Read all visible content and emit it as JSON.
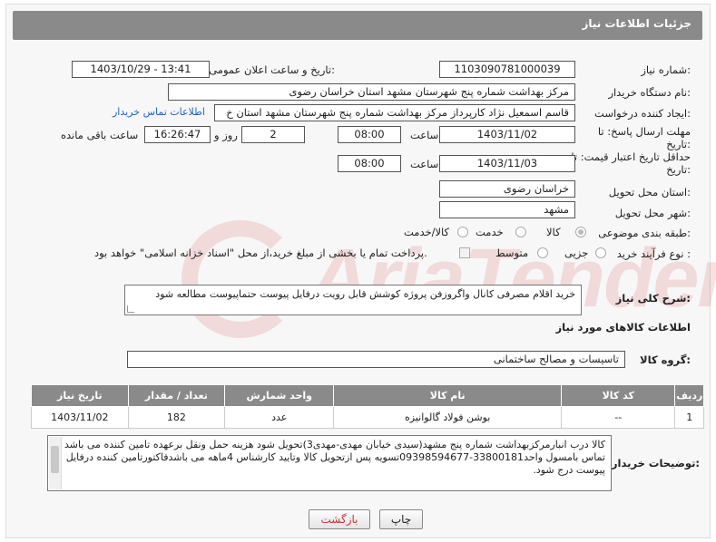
{
  "header": {
    "title": "جزئیات اطلاعات نیاز"
  },
  "need_number": {
    "label": "شماره نیاز:",
    "value": "1103090781000039"
  },
  "announce": {
    "label": "تاریخ و ساعت اعلان عمومی:",
    "value": "1403/10/29 - 13:41"
  },
  "buyer_org": {
    "label": "نام دستگاه خریدار:",
    "value": "مرکز بهداشت شماره پنج شهرستان مشهد استان خراسان رضوی"
  },
  "requester": {
    "label": "ایجاد کننده درخواست:",
    "value": "قاسم  اسمعیل نژاد کارپرداز مرکز بهداشت شماره پنج شهرستان مشهد استان خ",
    "contact_link": "اطلاعات تماس خریدار"
  },
  "deadline": {
    "label_line1": "مهلت ارسال پاسخ: تا",
    "label_line2": "تاریخ:",
    "date": "1403/11/02",
    "time_label": "ساعت",
    "time": "08:00",
    "days": "2",
    "day_label": "روز و",
    "remaining": "16:26:47",
    "remaining_label": "ساعت باقی مانده"
  },
  "validity": {
    "label_line1": "حداقل تاریخ اعتبار قیمت: تا",
    "label_line2": "تاریخ:",
    "date": "1403/11/03",
    "time_label": "ساعت",
    "time": "08:00"
  },
  "delivery_province": {
    "label": "استان محل تحویل:",
    "value": "خراسان رضوی"
  },
  "delivery_city": {
    "label": "شهر محل تحویل:",
    "value": "مشهد"
  },
  "category": {
    "label": "طبقه بندی موضوعی:",
    "options": [
      "کالا",
      "خدمت",
      "کالا/خدمت"
    ]
  },
  "purchase_type": {
    "label": "نوع فرآیند خرید :",
    "options": [
      "جزیی",
      "متوسط"
    ],
    "payment_note": "پرداخت تمام یا بخشی از مبلغ خرید،از محل \"اسناد خزانه اسلامی\" خواهد بود."
  },
  "summary": {
    "label": "شرح کلی نیاز:",
    "value": "خرید اقلام مصرفی کانال واگروزفن پروژه کوشش قابل رویت درفایل پیوست حتماپیوست مطالعه شود"
  },
  "goods_section": {
    "title": "اطلاعات کالاهای مورد نیاز"
  },
  "goods_group": {
    "label": "گروه کالا:",
    "value": "تاسیسات و مصالح ساختمانی"
  },
  "table": {
    "headers": [
      "ردیف",
      "کد کالا",
      "نام کالا",
      "واحد شمارش",
      "تعداد / مقدار",
      "تاریخ نیاز"
    ],
    "rows": [
      [
        "1",
        "--",
        "بوشن فولاد گالوانیزه",
        "عدد",
        "182",
        "1403/11/02"
      ]
    ]
  },
  "buyer_notes": {
    "label": "توضیحات خریدار:",
    "value": "کالا درب انبارمرکزبهداشت شماره پنج مشهد(سیدی خیابان مهدی-مهدی3)تحویل شود هزینه حمل ونقل برعهده تامین کننده می باشد  تماس بامسول واحد33800181-09398594677تسویه پس ازتحویل کالا وتایید کارشناس 4ماهه می باشدفاکتورتامین کننده درفایل پیوست درج شود."
  },
  "buttons": {
    "print": "چاپ",
    "back": "بازگشت"
  },
  "watermark": {
    "text": "AriaTender.neT"
  }
}
